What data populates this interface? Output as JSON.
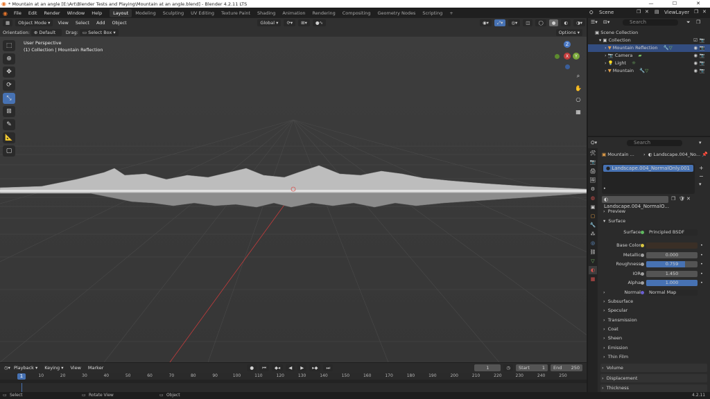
{
  "window": {
    "title": "* Mountain at an angle [E:\\Art\\Blender Tests and Playing\\Mountain at an angle.blend] - Blender 4.2.11 LTS",
    "buttons": [
      "—",
      "☐",
      "✕"
    ]
  },
  "menu": [
    "File",
    "Edit",
    "Render",
    "Window",
    "Help"
  ],
  "workspaces": [
    "Layout",
    "Modeling",
    "Sculpting",
    "UV Editing",
    "Texture Paint",
    "Shading",
    "Animation",
    "Rendering",
    "Compositing",
    "Geometry Nodes",
    "Scripting",
    "+"
  ],
  "scene": {
    "scene_label": "Scene",
    "viewlayer_label": "ViewLayer"
  },
  "viewport_header": {
    "mode": "Object Mode",
    "menus": [
      "View",
      "Select",
      "Add",
      "Object"
    ],
    "transform": "Global",
    "options": "Options",
    "orientation_label": "Orientation:",
    "orientation_value": "Default",
    "drag_label": "Drag:",
    "drag_value": "Select Box"
  },
  "viewport": {
    "view_name": "User Perspective",
    "collection_info": "(1) Collection | Mountain Reflection",
    "gizmo": {
      "z": "Z",
      "y": "Y",
      "x": "X"
    }
  },
  "tools": [
    "select-box",
    "cursor",
    "move",
    "rotate",
    "scale",
    "transform",
    "annotate",
    "measure",
    "add-cube"
  ],
  "outliner": {
    "search_placeholder": "Search",
    "root": "Scene Collection",
    "collection": "Collection",
    "items": [
      {
        "name": "Mountain Reflection",
        "color": "#e8a24a"
      },
      {
        "name": "Camera",
        "color": "#e8a24a"
      },
      {
        "name": "Light",
        "color": "#e8a24a"
      },
      {
        "name": "Mountain",
        "color": "#e8a24a"
      }
    ]
  },
  "properties": {
    "search_placeholder": "Search",
    "object_breadcrumb": "Mountain ...",
    "material_breadcrumb": "Landscape.004_No...",
    "slot": "Landscape.004_NormalOnly.001",
    "material_name": "Landscape.004_NormalO...",
    "sections": {
      "preview": "Preview",
      "surface": "Surface",
      "subsurface": "Subsurface",
      "specular": "Specular",
      "transmission": "Transmission",
      "coat": "Coat",
      "sheen": "Sheen",
      "emission": "Emission",
      "thin_film": "Thin Film",
      "volume": "Volume",
      "displacement": "Displacement",
      "thickness": "Thickness"
    },
    "surface_label": "Surface",
    "surface_value": "Principled BSDF",
    "base_color_label": "Base Color",
    "base_color": "#3a2f26",
    "metallic_label": "Metallic",
    "metallic": "0.000",
    "roughness_label": "Roughness",
    "roughness": "0.759",
    "roughness_fraction": 0.759,
    "ior_label": "IOR",
    "ior": "1.450",
    "alpha_label": "Alpha",
    "alpha": "1.000",
    "alpha_fraction": 1.0,
    "normal_label": "Normal",
    "normal_value": "Normal Map"
  },
  "timeline": {
    "menus": [
      "Playback",
      "Keying",
      "View",
      "Marker"
    ],
    "current_frame": "1",
    "start_label": "Start",
    "start": "1",
    "end_label": "End",
    "end": "250",
    "ticks": [
      "1",
      "10",
      "20",
      "30",
      "40",
      "50",
      "60",
      "70",
      "80",
      "90",
      "100",
      "110",
      "120",
      "130",
      "140",
      "150",
      "160",
      "170",
      "180",
      "190",
      "200",
      "210",
      "220",
      "230",
      "240",
      "250"
    ]
  },
  "status": {
    "select": "Select",
    "rotate": "Rotate View",
    "object": "Object",
    "version": "4.2.11"
  },
  "colors": {
    "accent": "#4772b3",
    "viewport_bg": "#3d3d3d",
    "x_axis": "#c43c3c"
  }
}
